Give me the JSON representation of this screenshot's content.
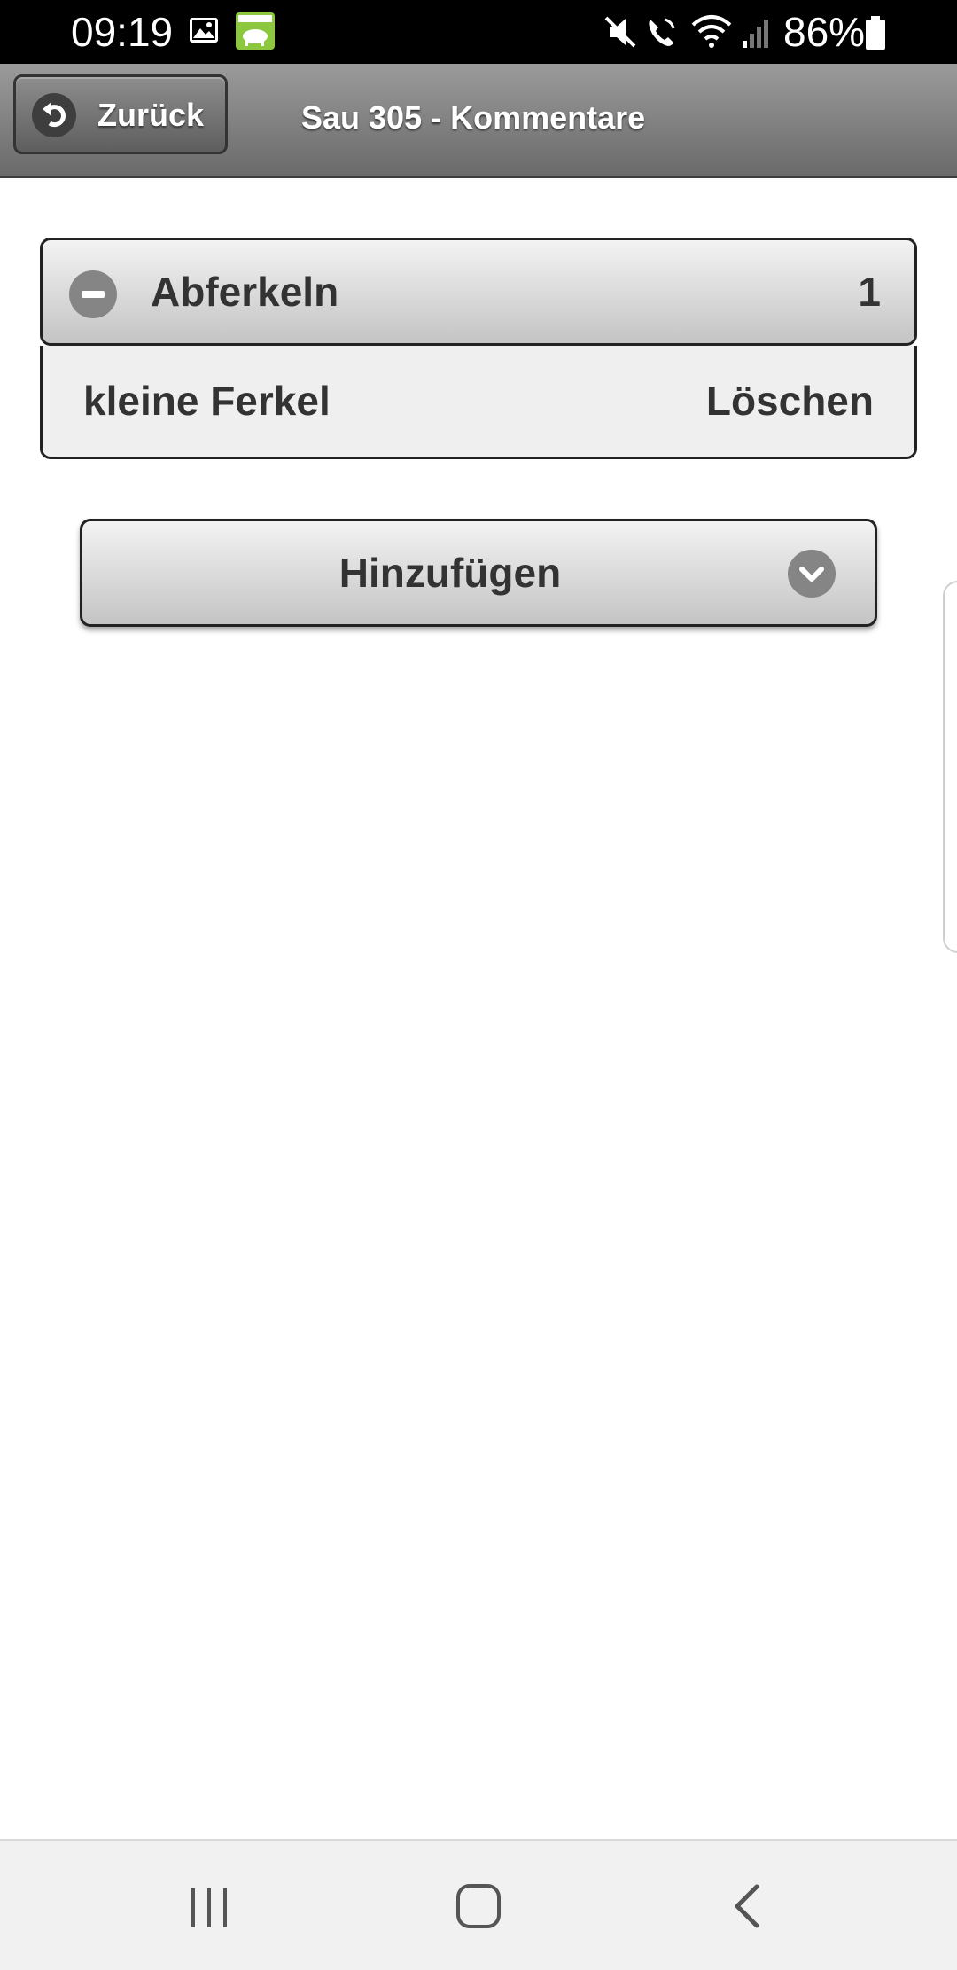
{
  "status_bar": {
    "time": "09:19",
    "battery": "86%",
    "icons": [
      "gallery-icon",
      "pig-app-icon",
      "mute-icon",
      "wifi-call-icon",
      "wifi-icon",
      "signal-icon",
      "battery-icon"
    ]
  },
  "header": {
    "back_label": "Zurück",
    "title": "Sau 305 - Kommentare"
  },
  "section": {
    "title": "Abferkeln",
    "count": "1",
    "items": [
      {
        "text": "kleine Ferkel",
        "action": "Löschen"
      }
    ]
  },
  "add_select": {
    "label": "Hinzufügen"
  },
  "colors": {
    "header_top": "#9b9b9b",
    "header_bottom": "#6a6a6a",
    "button_top": "#f3f3f3",
    "button_bottom": "#c4c4c4",
    "app_icon_green": "#8dc63f"
  }
}
